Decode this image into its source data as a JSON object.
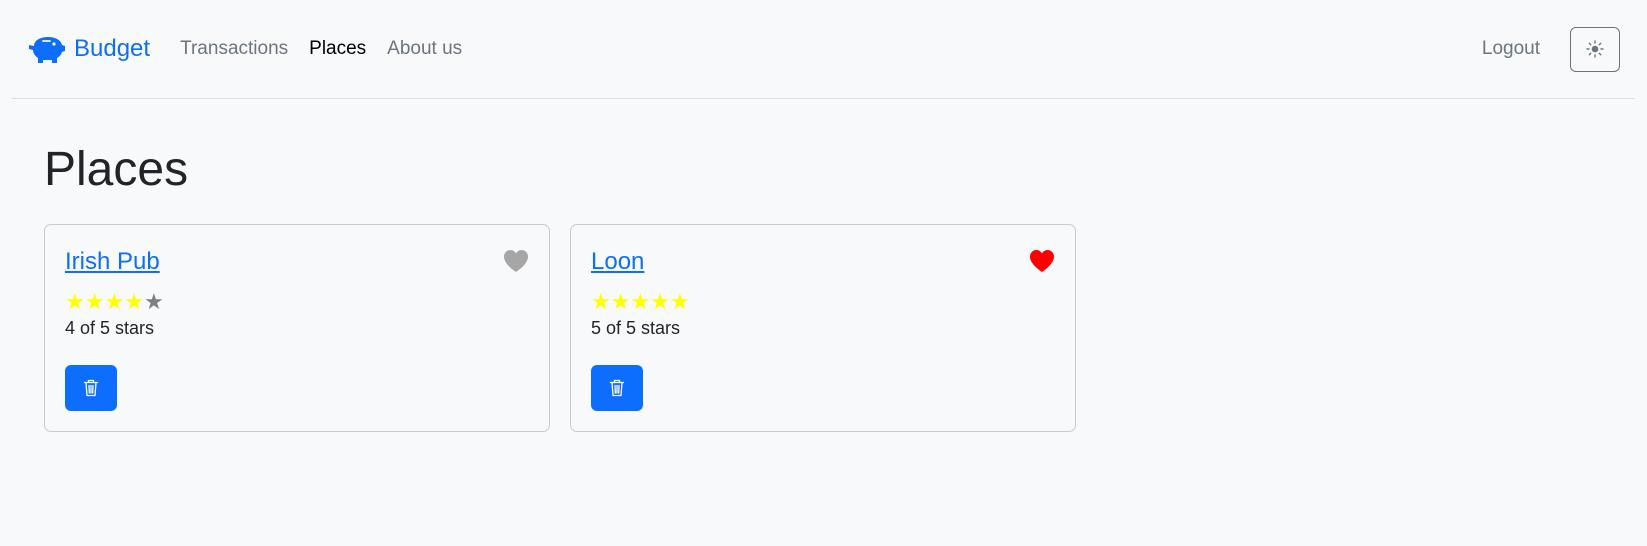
{
  "navbar": {
    "brand": "Budget",
    "links": [
      {
        "label": "Transactions",
        "active": false
      },
      {
        "label": "Places",
        "active": true
      },
      {
        "label": "About us",
        "active": false
      }
    ],
    "logout": "Logout",
    "theme_icon": "sun-icon"
  },
  "page": {
    "title": "Places"
  },
  "places": [
    {
      "name": "Irish Pub",
      "stars": 4,
      "max_stars": 5,
      "rating_text": "4 of 5 stars",
      "favorite": false
    },
    {
      "name": "Loon",
      "stars": 5,
      "max_stars": 5,
      "rating_text": "5 of 5 stars",
      "favorite": true
    }
  ],
  "colors": {
    "accent": "#0d6efd",
    "star_filled": "#ffff00",
    "star_empty": "#808080",
    "heart_favorite": "#ff0000",
    "heart_not_favorite": "#a6a6a6"
  }
}
